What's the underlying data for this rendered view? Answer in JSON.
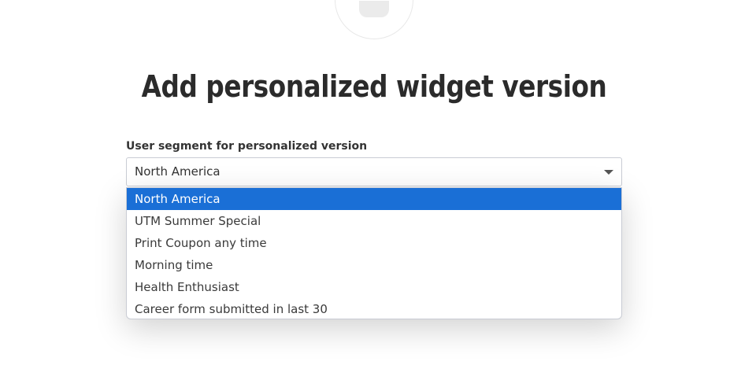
{
  "heading": "Add personalized widget version",
  "segment_field": {
    "label": "User segment for personalized version",
    "selected_value": "North America",
    "options": [
      {
        "label": "North America",
        "selected": true
      },
      {
        "label": "UTM Summer Special",
        "selected": false
      },
      {
        "label": "Print Coupon any time",
        "selected": false
      },
      {
        "label": "Morning time",
        "selected": false
      },
      {
        "label": "Health Enthusiast",
        "selected": false
      },
      {
        "label": "Career form submitted in last 30",
        "selected": false
      }
    ]
  },
  "icons": {
    "avatar": "user-avatar-icon",
    "dropdown_caret": "chevron-down-icon"
  },
  "colors": {
    "highlight": "#1a6fd6",
    "text": "#333333"
  }
}
